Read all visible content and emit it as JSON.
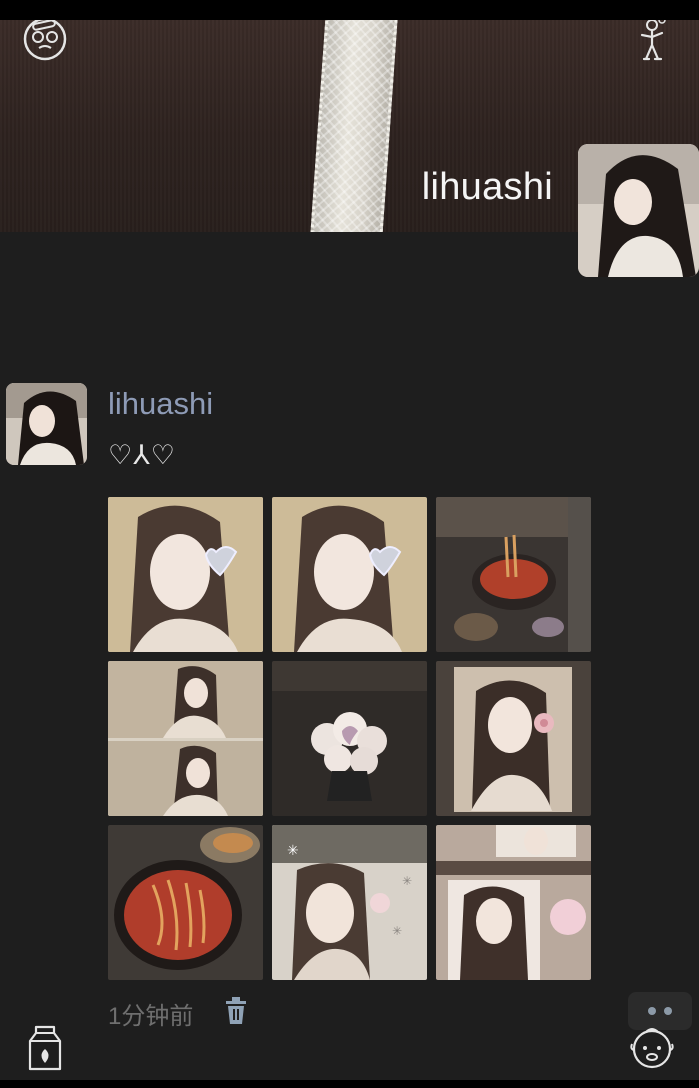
{
  "cover": {
    "username": "lihuashi"
  },
  "top_icons": {
    "left": "face-with-bandage-emoji",
    "right": "person-juggling-emoji"
  },
  "post": {
    "username": "lihuashi",
    "text": "♡⅄♡",
    "photos": [
      {
        "name": "selfie-heart-compact-1"
      },
      {
        "name": "selfie-heart-compact-2"
      },
      {
        "name": "pasta-table"
      },
      {
        "name": "photo-booth-strip"
      },
      {
        "name": "rose-bouquet"
      },
      {
        "name": "selfie-flower"
      },
      {
        "name": "spaghetti-closeup"
      },
      {
        "name": "selfie-sparkle"
      },
      {
        "name": "flower-collage"
      }
    ],
    "time": "1分钟前"
  },
  "bottom_icons": {
    "left": "milk-carton-emoji",
    "right": "baby-face-emoji"
  },
  "colors": {
    "background": "#1e1e1e",
    "username": "#8e9bb6",
    "time": "#6f6f6f"
  }
}
